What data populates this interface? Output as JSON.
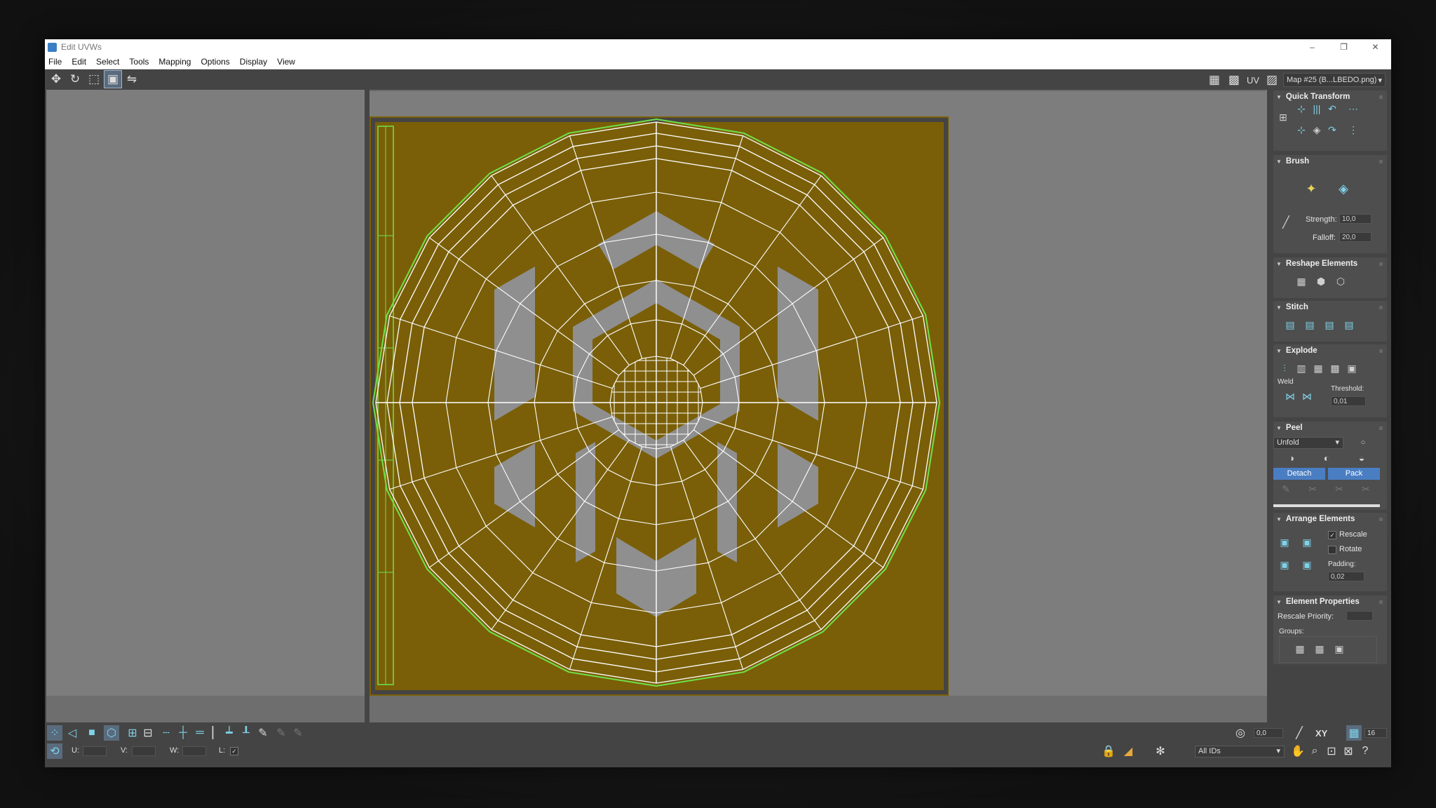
{
  "window": {
    "title": "Edit UVWs",
    "minimize": "–",
    "maximize": "❐",
    "close": "✕"
  },
  "menu": [
    "File",
    "Edit",
    "Select",
    "Tools",
    "Mapping",
    "Options",
    "Display",
    "View"
  ],
  "toolbar": {
    "icons": [
      "move-icon",
      "rotate-icon",
      "scale-icon",
      "freeform-icon",
      "mirror-icon"
    ],
    "uv_label": "UV",
    "map_select": "Map #25 (B...LBEDO.png)"
  },
  "panel": {
    "quick_transform": "Quick Transform",
    "brush": {
      "title": "Brush",
      "strength_label": "Strength:",
      "strength": "10,0",
      "falloff_label": "Falloff:",
      "falloff": "20,0"
    },
    "reshape": "Reshape Elements",
    "stitch": "Stitch",
    "explode": {
      "title": "Explode",
      "weld_label": "Weld",
      "threshold_label": "Threshold:",
      "threshold": "0,01"
    },
    "peel": {
      "title": "Peel",
      "mode": "Unfold",
      "detach": "Detach",
      "pack": "Pack"
    },
    "arrange": {
      "title": "Arrange Elements",
      "rescale": "Rescale",
      "rescale_checked": true,
      "rotate": "Rotate",
      "rotate_checked": false,
      "padding_label": "Padding:",
      "padding": "0,02"
    },
    "element_props": {
      "title": "Element Properties",
      "rescale_priority": "Rescale Priority:",
      "groups": "Groups:"
    }
  },
  "bottom": {
    "soft_value": "0,0",
    "xy_label": "XY",
    "grid_value": "16",
    "u_label": "U:",
    "v_label": "V:",
    "w_label": "W:",
    "l_label": "L:",
    "ids_select": "All IDs"
  },
  "colors": {
    "texture": "#7a5f08",
    "wire": "#ffffff",
    "border_wire": "#6fe04a",
    "accent": "#4a7ec2"
  }
}
